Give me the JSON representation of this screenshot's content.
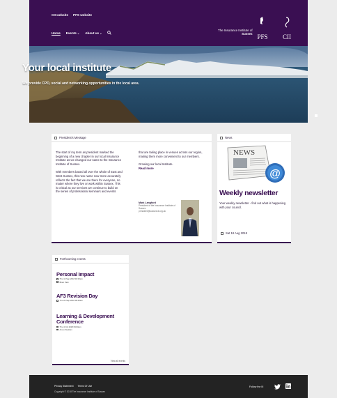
{
  "header": {
    "top_links": [
      "CII website",
      "PFS website"
    ],
    "nav": [
      {
        "label": "Home",
        "has_menu": false
      },
      {
        "label": "Events",
        "has_menu": true
      },
      {
        "label": "About us",
        "has_menu": true
      }
    ],
    "institute_line1": "The Insurance Institute of",
    "institute_line2": "Sussex",
    "pfs_logo": "PFS",
    "cii_logo": "CII"
  },
  "hero": {
    "title": "Your local institute",
    "subtitle": "We provide CPD, social and networking opportunities in the local area."
  },
  "president": {
    "heading": "President's Message",
    "col1": [
      "The start of my term as president marked the beginning of a new chapter in our local Insurance Institute as we changed our name to the Insurance Institute of Sussex.",
      "With members based all over the whole of East and West Sussex, this new name now more accurately reflects the fact that we are there for everyone, no matter where they live or work within Sussex. This is critical as our services we continue to build on the series of professional seminars and events"
    ],
    "col2": [
      "that are taking place in venues across our region, making them more convenient to our members.",
      "Growing our local Institute."
    ],
    "read_more": "Read more",
    "sig_name": "Mark Langford",
    "sig_title": "President of the Insurance Institute of Sussex",
    "sig_email": "president@sussexcii.org.uk"
  },
  "news": {
    "heading": "News",
    "image_text": "NEWS",
    "title": "Weekly newsletter",
    "description": "Your weekly newsletter - find out what is happening with your council.",
    "date": "Sat 18 Aug 2018"
  },
  "events": {
    "heading": "Forthcoming events",
    "items": [
      {
        "title": "Personal Impact",
        "date": "Thu 13 Sep 2018 18:00pm",
        "venue": "Brain Park"
      },
      {
        "title": "AF3 Revision Day",
        "date": "Thu 20 Sep 2018 09:00am",
        "venue": ""
      },
      {
        "title": "Learning & Development Conference",
        "date": "Thu 4 Oct 2018 09:00am",
        "venue": "Amex Stadium"
      }
    ],
    "view_all": "View all events"
  },
  "footer": {
    "links": [
      "Privacy Statement",
      "Terms Of Use"
    ],
    "copyright": "Copyright © 2018 The Insurance Institute of Sussex",
    "follow_label": "Follow the III"
  },
  "colors": {
    "brand_purple": "#3a0f52",
    "footer_dark": "#232323",
    "page_bg": "#ececec"
  }
}
